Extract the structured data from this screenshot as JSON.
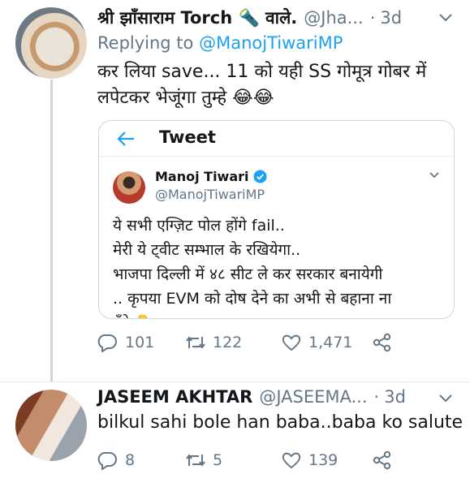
{
  "reply": {
    "author": {
      "name": "श्री झाँसाराम Torch 🔦 वाले.",
      "handle": "@Jha...",
      "time": "3d"
    },
    "replying_to_label": "Replying to",
    "replying_to_handle": "@ManojTiwariMP",
    "text_line1": "कर लिया save... 11 को यही SS गोमूत्र गोबर में",
    "text_line2": "लपेटकर भेजूंगा तुम्हे 😂😂",
    "quoted": {
      "header_title": "Tweet",
      "author_name": "Manoj Tiwari",
      "author_handle": "@ManojTiwariMP",
      "lines": [
        "ये सभी एग्ज़िट पोल होंगे fail..",
        "मेरी ये ट्वीट सम्भाल के रखियेगा..",
        "भाजपा दिल्ली में ४८ सीट ले कर सरकार बनायेगी",
        ".. कृपया EVM को दोष देने का अभी से बहाना ना",
        "ढूँढे 👇"
      ]
    },
    "stats": {
      "replies": "101",
      "retweets": "122",
      "likes": "1,471"
    }
  },
  "second": {
    "author": {
      "name": "JASEEM AKHTAR",
      "handle": "@JASEEMA...",
      "time": "3d"
    },
    "text": "bilkul sahi bole han baba..baba ko salute",
    "stats": {
      "replies": "8",
      "retweets": "5",
      "likes": "139"
    }
  },
  "colors": {
    "link": "#1da1f2",
    "muted": "#657786",
    "border": "#ccd6dd",
    "verified": "#1da1f2"
  },
  "icons": [
    "reply-icon",
    "retweet-icon",
    "like-icon",
    "share-icon",
    "chevron-down-icon",
    "back-arrow-icon",
    "verified-badge-icon"
  ]
}
